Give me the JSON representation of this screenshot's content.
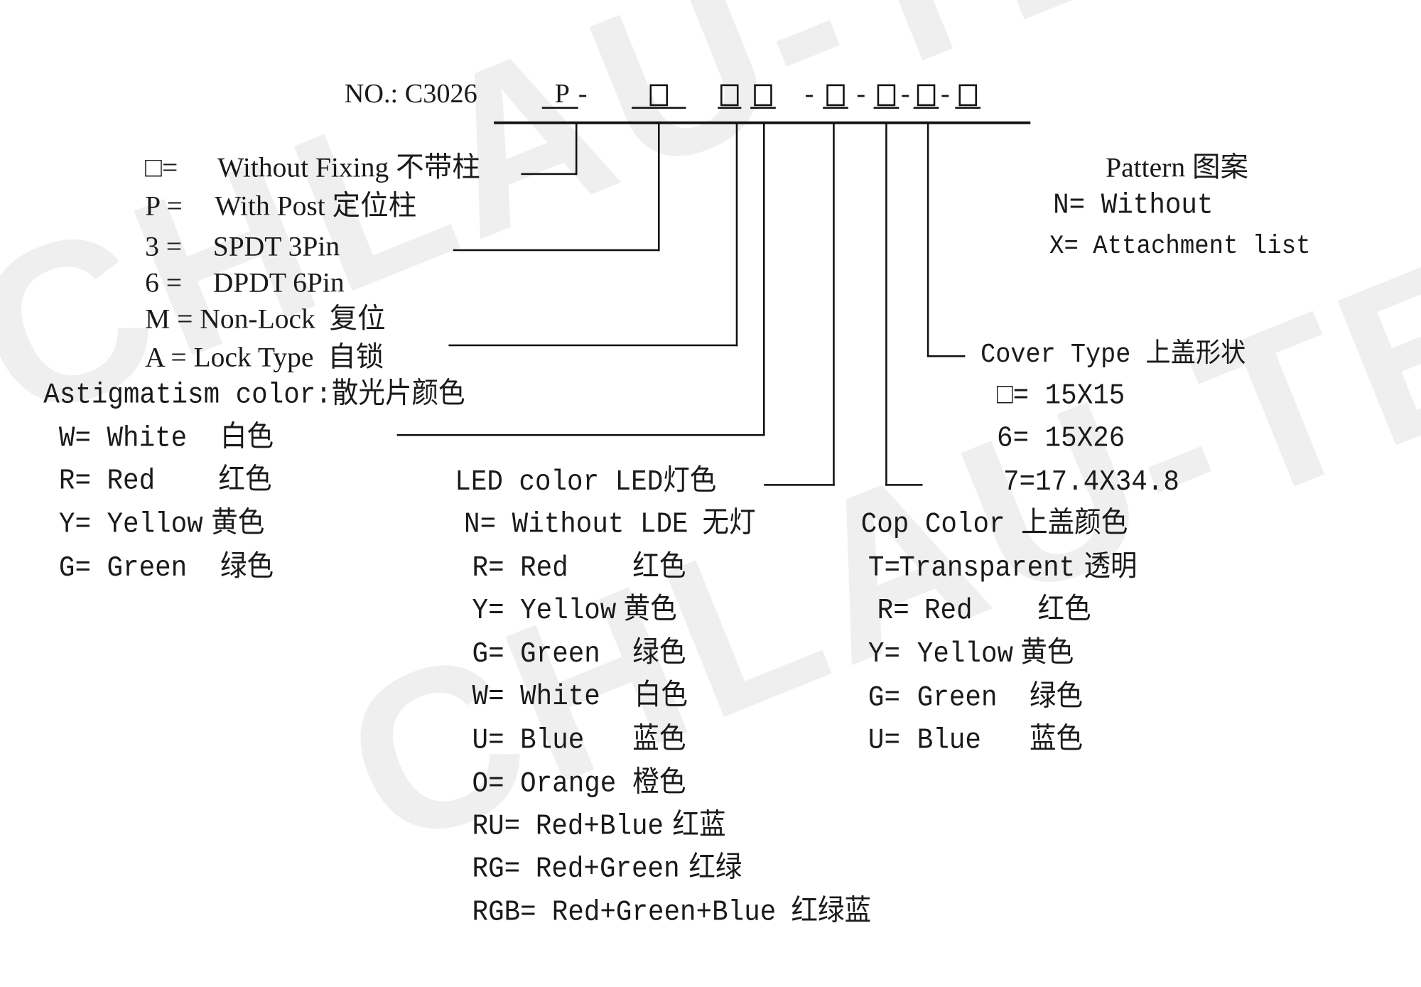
{
  "watermark": "CHLAU-TECH",
  "code": {
    "prefix": "NO.: C3026",
    "p": "P",
    "dash": "-"
  },
  "fixing": [
    {
      "code": "□=",
      "text": "Without Fixing 不带柱"
    },
    {
      "code": "P =",
      "text": "With Post 定位柱"
    }
  ],
  "pins": [
    {
      "code": "3 =",
      "text": "SPDT 3Pin"
    },
    {
      "code": "6 =",
      "text": "DPDT 6Pin"
    }
  ],
  "lock": [
    {
      "text": "M = Non-Lock  复位"
    },
    {
      "text": "A = Lock Type  自锁"
    }
  ],
  "astigmatism": {
    "title": "Astigmatism color:散光片颜色",
    "items": [
      {
        "code": "W=",
        "name": "White",
        "cn": "白色"
      },
      {
        "code": "R=",
        "name": "Red",
        "cn": "红色"
      },
      {
        "code": "Y=",
        "name": "Yellow",
        "cn": "黄色"
      },
      {
        "code": "G=",
        "name": "Green",
        "cn": "绿色"
      }
    ]
  },
  "led": {
    "title": "LED color LED灯色",
    "items": [
      {
        "code": "N=",
        "name": "Without LDE",
        "cn": "无灯"
      },
      {
        "code": "R=",
        "name": "Red",
        "cn": "红色"
      },
      {
        "code": "Y=",
        "name": "Yellow",
        "cn": "黄色"
      },
      {
        "code": "G=",
        "name": "Green",
        "cn": "绿色"
      },
      {
        "code": "W=",
        "name": "White",
        "cn": "白色"
      },
      {
        "code": "U=",
        "name": "Blue",
        "cn": "蓝色"
      },
      {
        "code": "O=",
        "name": "Orange",
        "cn": "橙色"
      },
      {
        "code": "RU=",
        "name": "Red+Blue",
        "cn": "红蓝"
      },
      {
        "code": "RG=",
        "name": "Red+Green",
        "cn": "红绿"
      },
      {
        "code": "RGB=",
        "name": "Red+Green+Blue",
        "cn": "红绿蓝"
      }
    ]
  },
  "cop": {
    "title": "Cop Color 上盖颜色",
    "items": [
      {
        "code": "T=",
        "name": "Transparent",
        "cn": "透明"
      },
      {
        "code": "R=",
        "name": "Red",
        "cn": "红色"
      },
      {
        "code": "Y=",
        "name": "Yellow",
        "cn": "黄色"
      },
      {
        "code": "G=",
        "name": "Green",
        "cn": "绿色"
      },
      {
        "code": "U=",
        "name": "Blue",
        "cn": "蓝色"
      }
    ]
  },
  "cover": {
    "title": "Cover Type 上盖形状",
    "items": [
      {
        "text": "□= 15X15"
      },
      {
        "text": "6= 15X26"
      },
      {
        "text": "7=17.4X34.8"
      }
    ]
  },
  "pattern": {
    "title": "Pattern 图案",
    "items": [
      {
        "text": "N= Without"
      },
      {
        "text": "X= Attachment list"
      }
    ]
  }
}
